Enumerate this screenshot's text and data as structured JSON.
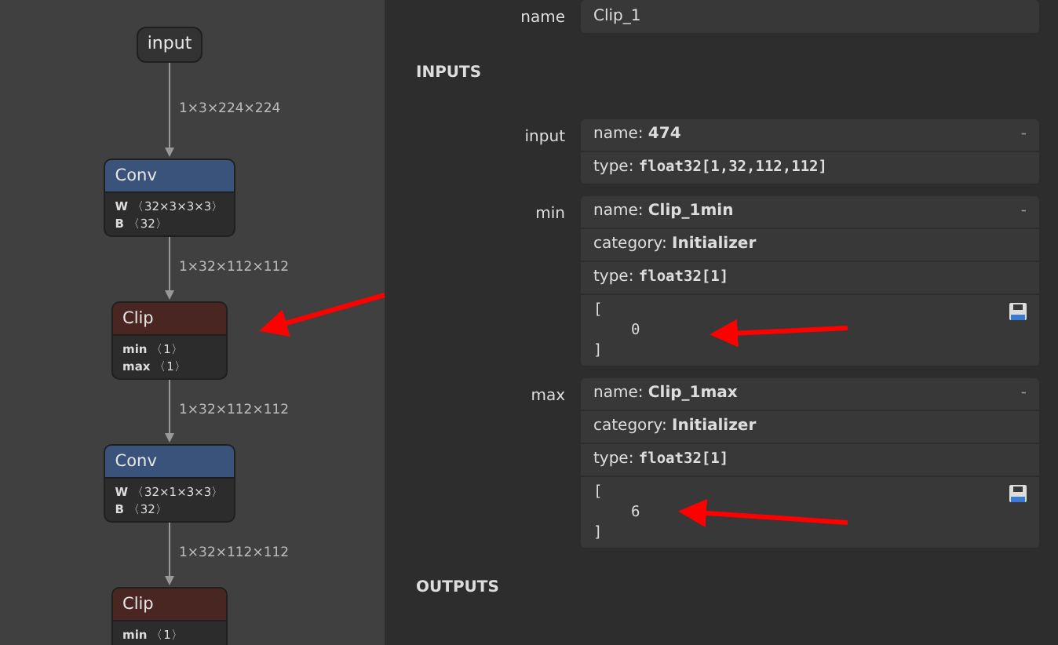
{
  "graph": {
    "nodes": [
      {
        "kind": "input",
        "title": "input"
      },
      {
        "kind": "operator",
        "title": "Conv",
        "color": "#39537a",
        "attributes": [
          {
            "name": "W",
            "shape": "〈32×3×3×3〉"
          },
          {
            "name": "B",
            "shape": "〈32〉"
          }
        ]
      },
      {
        "kind": "operator",
        "title": "Clip",
        "color": "#4a2622",
        "attributes": [
          {
            "name": "min",
            "shape": "〈1〉"
          },
          {
            "name": "max",
            "shape": "〈1〉"
          }
        ]
      },
      {
        "kind": "operator",
        "title": "Conv",
        "color": "#39537a",
        "attributes": [
          {
            "name": "W",
            "shape": "〈32×1×3×3〉"
          },
          {
            "name": "B",
            "shape": "〈32〉"
          }
        ]
      },
      {
        "kind": "operator",
        "title": "Clip",
        "color": "#4a2622",
        "attributes": [
          {
            "name": "min",
            "shape": "〈1〉"
          }
        ]
      }
    ],
    "edges": [
      "1×3×224×224",
      "1×32×112×112",
      "1×32×112×112",
      "1×32×112×112"
    ]
  },
  "properties": {
    "label": "name",
    "value": "Clip_1"
  },
  "sections": [
    {
      "title": "INPUTS",
      "arguments": [
        {
          "label": "input",
          "toggle": "-",
          "fields": [
            {
              "key": "name: ",
              "value": "474",
              "kind": "bold"
            },
            {
              "key": "type: ",
              "value": "float32[1,32,112,112]",
              "kind": "mono"
            }
          ]
        },
        {
          "label": "min",
          "toggle": "-",
          "fields": [
            {
              "key": "name: ",
              "value": "Clip_1min",
              "kind": "bold"
            },
            {
              "key": "category: ",
              "value": "Initializer",
              "kind": "bold"
            },
            {
              "key": "type: ",
              "value": "float32[1]",
              "kind": "mono"
            }
          ],
          "tensor": [
            "[",
            "0",
            "]"
          ]
        },
        {
          "label": "max",
          "toggle": "-",
          "fields": [
            {
              "key": "name: ",
              "value": "Clip_1max",
              "kind": "bold"
            },
            {
              "key": "category: ",
              "value": "Initializer",
              "kind": "bold"
            },
            {
              "key": "type: ",
              "value": "float32[1]",
              "kind": "mono"
            }
          ],
          "tensor": [
            "[",
            "6",
            "]"
          ]
        }
      ]
    },
    {
      "title": "OUTPUTS"
    }
  ]
}
